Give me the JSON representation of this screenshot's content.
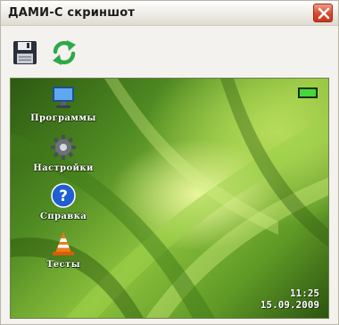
{
  "window": {
    "title": "ДАМИ-С скриншот",
    "close_icon": "close-icon"
  },
  "toolbar": {
    "save_icon": "floppy-disk-icon",
    "refresh_icon": "refresh-arrows-icon"
  },
  "device_screen": {
    "icons": [
      {
        "label": "Программы",
        "icon": "monitor-icon"
      },
      {
        "label": "Настройки",
        "icon": "gear-icon"
      },
      {
        "label": "Справка",
        "icon": "help-question-icon"
      },
      {
        "label": "Тесты",
        "icon": "traffic-cone-icon"
      }
    ],
    "battery_level": 1.0,
    "time": "11:25",
    "date": "15.09.2009"
  },
  "colors": {
    "close_button": "#d9472b",
    "refresh_green": "#2fa84a",
    "battery_green": "#46d83b",
    "wallpaper_green": "#6fa82c"
  }
}
